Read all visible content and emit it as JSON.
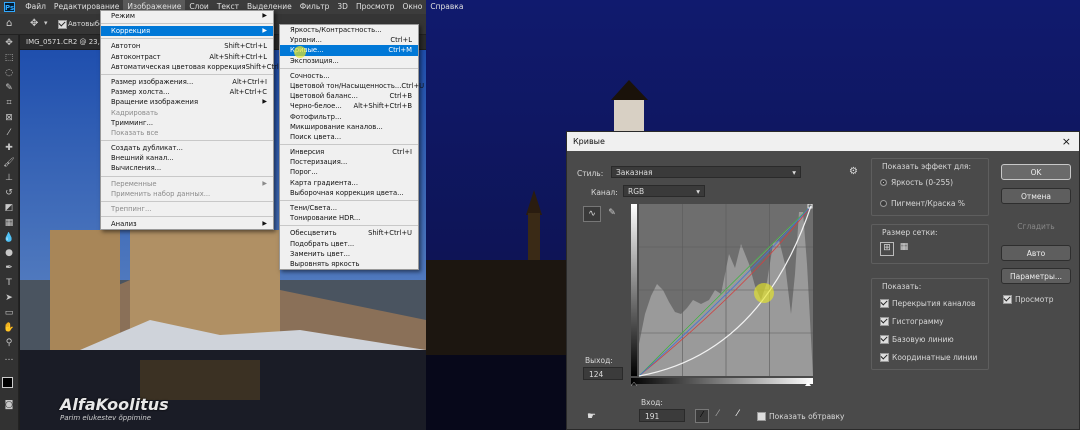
{
  "menubar": {
    "logo": "Ps",
    "items": [
      "Файл",
      "Редактирование",
      "Изображение",
      "Слои",
      "Текст",
      "Выделение",
      "Фильтр",
      "3D",
      "Просмотр",
      "Окно",
      "Справка"
    ]
  },
  "options_bar": {
    "auto_select": "Автовыбо"
  },
  "doc_tab": {
    "label": "IMG_0571.CR2 @ 23,5% (RG"
  },
  "image_menu": [
    {
      "label": "Режим",
      "shortcut": "",
      "arrow": true
    },
    {
      "sep": true
    },
    {
      "label": "Коррекция",
      "shortcut": "",
      "arrow": true,
      "hl": true
    },
    {
      "sep": true
    },
    {
      "label": "Автотон",
      "shortcut": "Shift+Ctrl+L"
    },
    {
      "label": "Автоконтраст",
      "shortcut": "Alt+Shift+Ctrl+L"
    },
    {
      "label": "Автоматическая цветовая коррекция",
      "shortcut": "Shift+Ctrl+B"
    },
    {
      "sep": true
    },
    {
      "label": "Размер изображения...",
      "shortcut": "Alt+Ctrl+I"
    },
    {
      "label": "Размер холста...",
      "shortcut": "Alt+Ctrl+C"
    },
    {
      "label": "Вращение изображения",
      "shortcut": "",
      "arrow": true
    },
    {
      "label": "Кадрировать",
      "shortcut": "",
      "dis": true
    },
    {
      "label": "Тримминг...",
      "shortcut": ""
    },
    {
      "label": "Показать все",
      "shortcut": "",
      "dis": true
    },
    {
      "sep": true
    },
    {
      "label": "Создать дубликат...",
      "shortcut": ""
    },
    {
      "label": "Внешний канал...",
      "shortcut": ""
    },
    {
      "label": "Вычисления...",
      "shortcut": ""
    },
    {
      "sep": true
    },
    {
      "label": "Переменные",
      "shortcut": "",
      "arrow": true,
      "dis": true
    },
    {
      "label": "Применить набор данных...",
      "shortcut": "",
      "dis": true
    },
    {
      "sep": true
    },
    {
      "label": "Треппинг...",
      "shortcut": "",
      "dis": true
    },
    {
      "sep": true
    },
    {
      "label": "Анализ",
      "shortcut": "",
      "arrow": true
    }
  ],
  "adjust_menu": [
    {
      "label": "Яркость/Контрастность...",
      "shortcut": ""
    },
    {
      "label": "Уровни...",
      "shortcut": "Ctrl+L"
    },
    {
      "label": "Кривые...",
      "shortcut": "Ctrl+M",
      "hl": true
    },
    {
      "label": "Экспозиция...",
      "shortcut": ""
    },
    {
      "sep": true
    },
    {
      "label": "Сочность...",
      "shortcut": ""
    },
    {
      "label": "Цветовой тон/Насыщенность...",
      "shortcut": "Ctrl+U"
    },
    {
      "label": "Цветовой баланс...",
      "shortcut": "Ctrl+B"
    },
    {
      "label": "Черно-белое...",
      "shortcut": "Alt+Shift+Ctrl+B"
    },
    {
      "label": "Фотофильтр...",
      "shortcut": ""
    },
    {
      "label": "Микширование каналов...",
      "shortcut": ""
    },
    {
      "label": "Поиск цвета...",
      "shortcut": ""
    },
    {
      "sep": true
    },
    {
      "label": "Инверсия",
      "shortcut": "Ctrl+I"
    },
    {
      "label": "Постеризация...",
      "shortcut": ""
    },
    {
      "label": "Порог...",
      "shortcut": ""
    },
    {
      "label": "Карта градиента...",
      "shortcut": ""
    },
    {
      "label": "Выборочная коррекция цвета...",
      "shortcut": ""
    },
    {
      "sep": true
    },
    {
      "label": "Тени/Света...",
      "shortcut": ""
    },
    {
      "label": "Тонирование HDR...",
      "shortcut": ""
    },
    {
      "sep": true
    },
    {
      "label": "Обесцветить",
      "shortcut": "Shift+Ctrl+U"
    },
    {
      "label": "Подобрать цвет...",
      "shortcut": ""
    },
    {
      "label": "Заменить цвет...",
      "shortcut": ""
    },
    {
      "label": "Выровнять яркость",
      "shortcut": ""
    }
  ],
  "curves": {
    "title": "Кривые",
    "close": "×",
    "preset_label": "Стиль:",
    "preset_value": "Заказная",
    "channel_label": "Канал:",
    "channel_value": "RGB",
    "output_label": "Выход:",
    "output_value": "124",
    "input_label": "Вход:",
    "input_value": "191",
    "show_clipping": "Показать обтравку",
    "show_amount": "Показать эффект для:",
    "light": "Яркость (0-255)",
    "pigment": "Пигмент/Краска %",
    "grid_size": "Размер сетки:",
    "show": "Показать:",
    "channel_overlays": "Перекрытия каналов",
    "histogram": "Гистограмму",
    "baseline": "Базовую линию",
    "intersection": "Координатные линии",
    "ok": "OK",
    "cancel": "Отмена",
    "smooth": "Сгладить",
    "auto": "Авто",
    "options": "Параметры...",
    "preview": "Просмотр"
  },
  "watermark": {
    "brand": "AlfaKoolitus",
    "tagline": "Parim elukestev õppimine"
  }
}
